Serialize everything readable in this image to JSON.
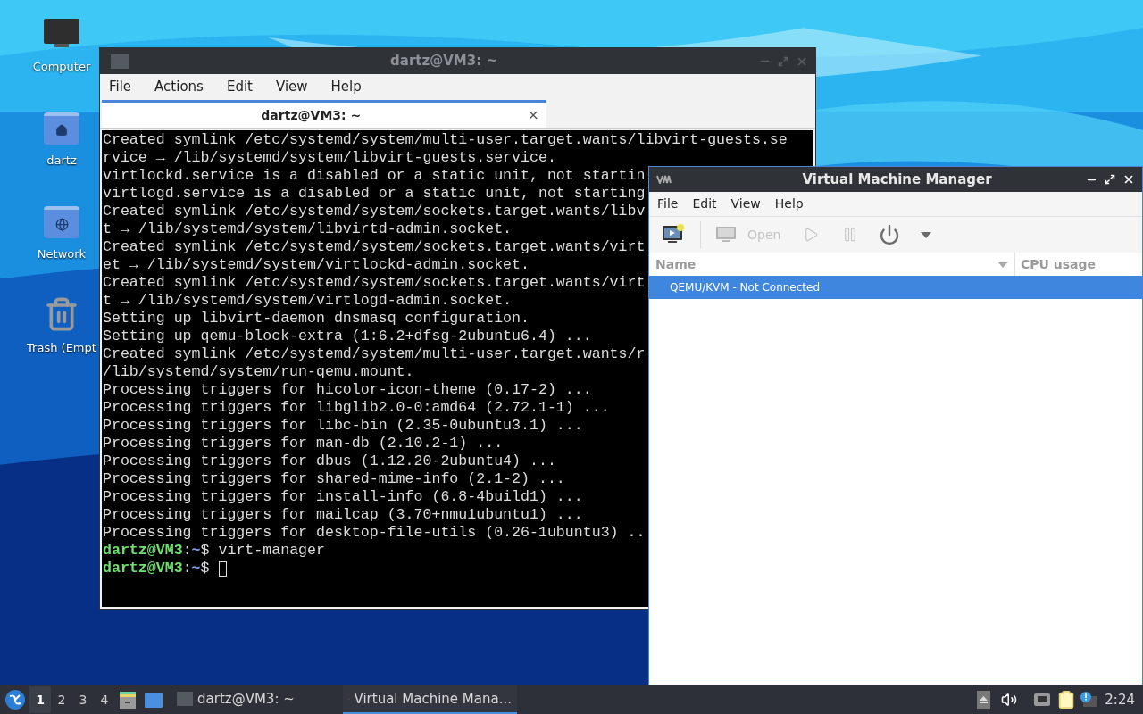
{
  "desktop_icons": [
    {
      "label": "Computer",
      "kind": "monitor"
    },
    {
      "label": "dartz",
      "kind": "home"
    },
    {
      "label": "Network",
      "kind": "network"
    },
    {
      "label": "Trash (Empt",
      "kind": "trash"
    }
  ],
  "terminal_window": {
    "title": "dartz@VM3: ~",
    "active": false,
    "menu": [
      "File",
      "Actions",
      "Edit",
      "View",
      "Help"
    ],
    "tabs": [
      {
        "label": "dartz@VM3: ~",
        "selected": true,
        "close": "×"
      }
    ],
    "lines": [
      {
        "kind": "output",
        "text": "Created symlink /etc/systemd/system/multi-user.target.wants/libvirt-guests.se"
      },
      {
        "kind": "output",
        "text": "rvice → /lib/systemd/system/libvirt-guests.service."
      },
      {
        "kind": "output",
        "text": "virtlockd.service is a disabled or a static unit, not startin"
      },
      {
        "kind": "output",
        "text": "virtlogd.service is a disabled or a static unit, not starting"
      },
      {
        "kind": "output",
        "text": "Created symlink /etc/systemd/system/sockets.target.wants/libv"
      },
      {
        "kind": "output",
        "text": "t → /lib/systemd/system/libvirtd-admin.socket."
      },
      {
        "kind": "output",
        "text": "Created symlink /etc/systemd/system/sockets.target.wants/virt"
      },
      {
        "kind": "output",
        "text": "et → /lib/systemd/system/virtlockd-admin.socket."
      },
      {
        "kind": "output",
        "text": "Created symlink /etc/systemd/system/sockets.target.wants/virt"
      },
      {
        "kind": "output",
        "text": "t → /lib/systemd/system/virtlogd-admin.socket."
      },
      {
        "kind": "output",
        "text": "Setting up libvirt-daemon dnsmasq configuration."
      },
      {
        "kind": "output",
        "text": "Setting up qemu-block-extra (1:6.2+dfsg-2ubuntu6.4) ..."
      },
      {
        "kind": "output",
        "text": "Created symlink /etc/systemd/system/multi-user.target.wants/r"
      },
      {
        "kind": "output",
        "text": "/lib/systemd/system/run-qemu.mount."
      },
      {
        "kind": "output",
        "text": "Processing triggers for hicolor-icon-theme (0.17-2) ..."
      },
      {
        "kind": "output",
        "text": "Processing triggers for libglib2.0-0:amd64 (2.72.1-1) ..."
      },
      {
        "kind": "output",
        "text": "Processing triggers for libc-bin (2.35-0ubuntu3.1) ..."
      },
      {
        "kind": "output",
        "text": "Processing triggers for man-db (2.10.2-1) ..."
      },
      {
        "kind": "output",
        "text": "Processing triggers for dbus (1.12.20-2ubuntu4) ..."
      },
      {
        "kind": "output",
        "text": "Processing triggers for shared-mime-info (2.1-2) ..."
      },
      {
        "kind": "output",
        "text": "Processing triggers for install-info (6.8-4build1) ..."
      },
      {
        "kind": "output",
        "text": "Processing triggers for mailcap (3.70+nmu1ubuntu1) ..."
      },
      {
        "kind": "output",
        "text": "Processing triggers for desktop-file-utils (0.26-1ubuntu3) .."
      },
      {
        "kind": "prompt",
        "user": "dartz@VM3",
        "sep": ":",
        "path": "~",
        "command": "$ virt-manager"
      },
      {
        "kind": "prompt",
        "user": "dartz@VM3",
        "sep": ":",
        "path": "~",
        "command": "$",
        "cursor": true
      }
    ]
  },
  "vmm_window": {
    "title": "Virtual Machine Manager",
    "active": true,
    "menu": [
      "File",
      "Edit",
      "View",
      "Help"
    ],
    "toolbar": [
      {
        "kind": "new-vm",
        "disabled": false
      },
      {
        "kind": "open",
        "label": "Open",
        "disabled": true
      },
      {
        "kind": "run",
        "disabled": true
      },
      {
        "kind": "pause",
        "disabled": true
      },
      {
        "kind": "power",
        "disabled": false
      },
      {
        "kind": "dropdown",
        "disabled": false
      }
    ],
    "columns": [
      "Name",
      "CPU usage"
    ],
    "rows": [
      {
        "name": "QEMU/KVM - Not Connected",
        "selected": true
      }
    ]
  },
  "taskbar": {
    "workspaces": [
      {
        "label": "1",
        "selected": true
      },
      {
        "label": "2",
        "selected": false
      },
      {
        "label": "3",
        "selected": false
      },
      {
        "label": "4",
        "selected": false
      }
    ],
    "tasks": [
      {
        "label": "dartz@VM3: ~",
        "kind": "terminal",
        "selected": false
      },
      {
        "label": "Virtual Machine Mana...",
        "kind": "vmm",
        "selected": true
      }
    ],
    "clock": "2:24"
  }
}
